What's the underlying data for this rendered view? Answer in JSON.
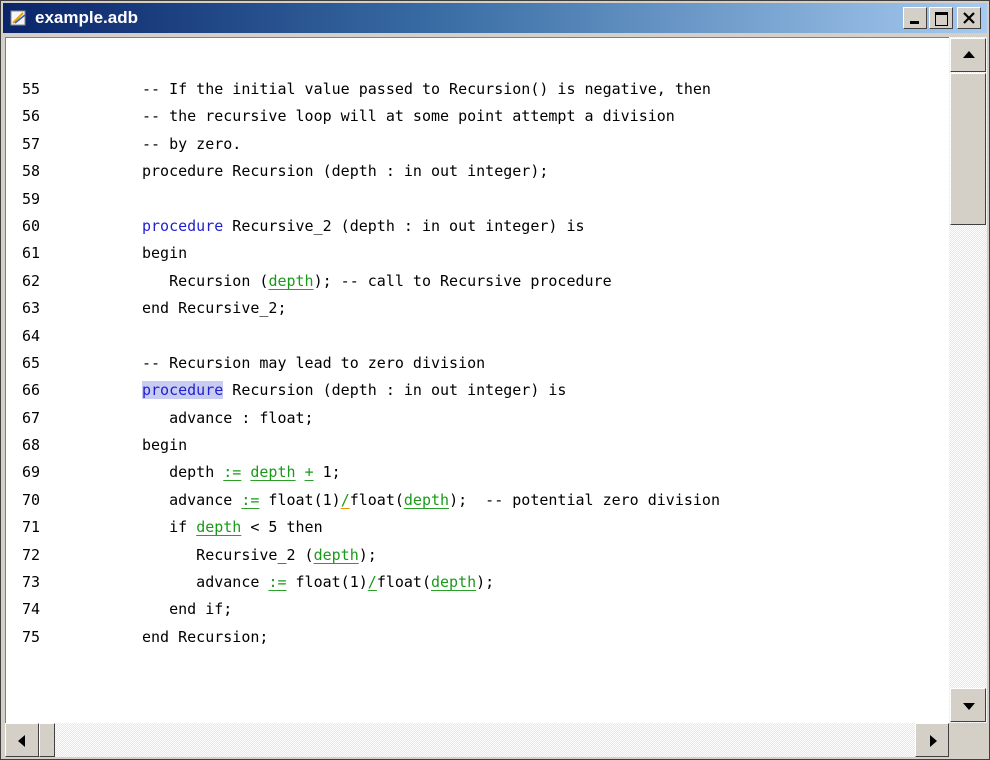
{
  "window": {
    "title": "example.adb"
  },
  "icons": {
    "app": "file-icon",
    "minimize": "minimize-icon",
    "maximize": "maximize-icon",
    "close": "close-icon"
  },
  "lines": [
    {
      "n": "55",
      "segs": [
        {
          "t": "-- If the initial value passed to Recursion() is negative, then",
          "c": ""
        }
      ]
    },
    {
      "n": "56",
      "segs": [
        {
          "t": "-- the recursive loop will at some point attempt a division",
          "c": ""
        }
      ]
    },
    {
      "n": "57",
      "segs": [
        {
          "t": "-- by zero.",
          "c": ""
        }
      ]
    },
    {
      "n": "58",
      "segs": [
        {
          "t": "procedure Recursion (depth : in out integer);",
          "c": ""
        }
      ]
    },
    {
      "n": "59",
      "segs": []
    },
    {
      "n": "60",
      "segs": [
        {
          "t": "procedure",
          "c": "kw"
        },
        {
          "t": " Recursive_2 (depth : in out integer) is",
          "c": ""
        }
      ]
    },
    {
      "n": "61",
      "segs": [
        {
          "t": "begin",
          "c": ""
        }
      ]
    },
    {
      "n": "62",
      "segs": [
        {
          "t": "   Recursion (",
          "c": ""
        },
        {
          "t": "depth",
          "c": "grn"
        },
        {
          "t": "); -- call to Recursive procedure",
          "c": ""
        }
      ]
    },
    {
      "n": "63",
      "segs": [
        {
          "t": "end Recursive_2;",
          "c": ""
        }
      ]
    },
    {
      "n": "64",
      "segs": []
    },
    {
      "n": "65",
      "segs": [
        {
          "t": "-- Recursion may lead to zero division",
          "c": ""
        }
      ]
    },
    {
      "n": "66",
      "segs": [
        {
          "t": "procedure",
          "c": "kw hl"
        },
        {
          "t": " Recursion (depth : in out integer) is",
          "c": ""
        }
      ]
    },
    {
      "n": "67",
      "segs": [
        {
          "t": "   advance : float;",
          "c": ""
        }
      ]
    },
    {
      "n": "68",
      "segs": [
        {
          "t": "begin",
          "c": ""
        }
      ]
    },
    {
      "n": "69",
      "segs": [
        {
          "t": "   depth ",
          "c": ""
        },
        {
          "t": ":=",
          "c": "grn"
        },
        {
          "t": " ",
          "c": ""
        },
        {
          "t": "depth",
          "c": "grn"
        },
        {
          "t": " ",
          "c": ""
        },
        {
          "t": "+",
          "c": "grn"
        },
        {
          "t": " 1;",
          "c": ""
        }
      ]
    },
    {
      "n": "70",
      "segs": [
        {
          "t": "   advance ",
          "c": ""
        },
        {
          "t": ":=",
          "c": "grn"
        },
        {
          "t": " float(1)",
          "c": ""
        },
        {
          "t": "/",
          "c": "org"
        },
        {
          "t": "float(",
          "c": ""
        },
        {
          "t": "depth",
          "c": "grn"
        },
        {
          "t": ");  -- potential zero division",
          "c": ""
        }
      ]
    },
    {
      "n": "71",
      "segs": [
        {
          "t": "   if ",
          "c": ""
        },
        {
          "t": "depth",
          "c": "grn"
        },
        {
          "t": " < 5 then",
          "c": ""
        }
      ]
    },
    {
      "n": "72",
      "segs": [
        {
          "t": "      Recursive_2 (",
          "c": ""
        },
        {
          "t": "depth",
          "c": "grn"
        },
        {
          "t": ");",
          "c": ""
        }
      ]
    },
    {
      "n": "73",
      "segs": [
        {
          "t": "      advance ",
          "c": ""
        },
        {
          "t": ":=",
          "c": "grn"
        },
        {
          "t": " float(1)",
          "c": ""
        },
        {
          "t": "/",
          "c": "grn"
        },
        {
          "t": "float(",
          "c": ""
        },
        {
          "t": "depth",
          "c": "grn"
        },
        {
          "t": ");",
          "c": ""
        }
      ]
    },
    {
      "n": "74",
      "segs": [
        {
          "t": "   end if;",
          "c": ""
        }
      ]
    },
    {
      "n": "75",
      "segs": [
        {
          "t": "end Recursion;",
          "c": ""
        }
      ]
    }
  ]
}
